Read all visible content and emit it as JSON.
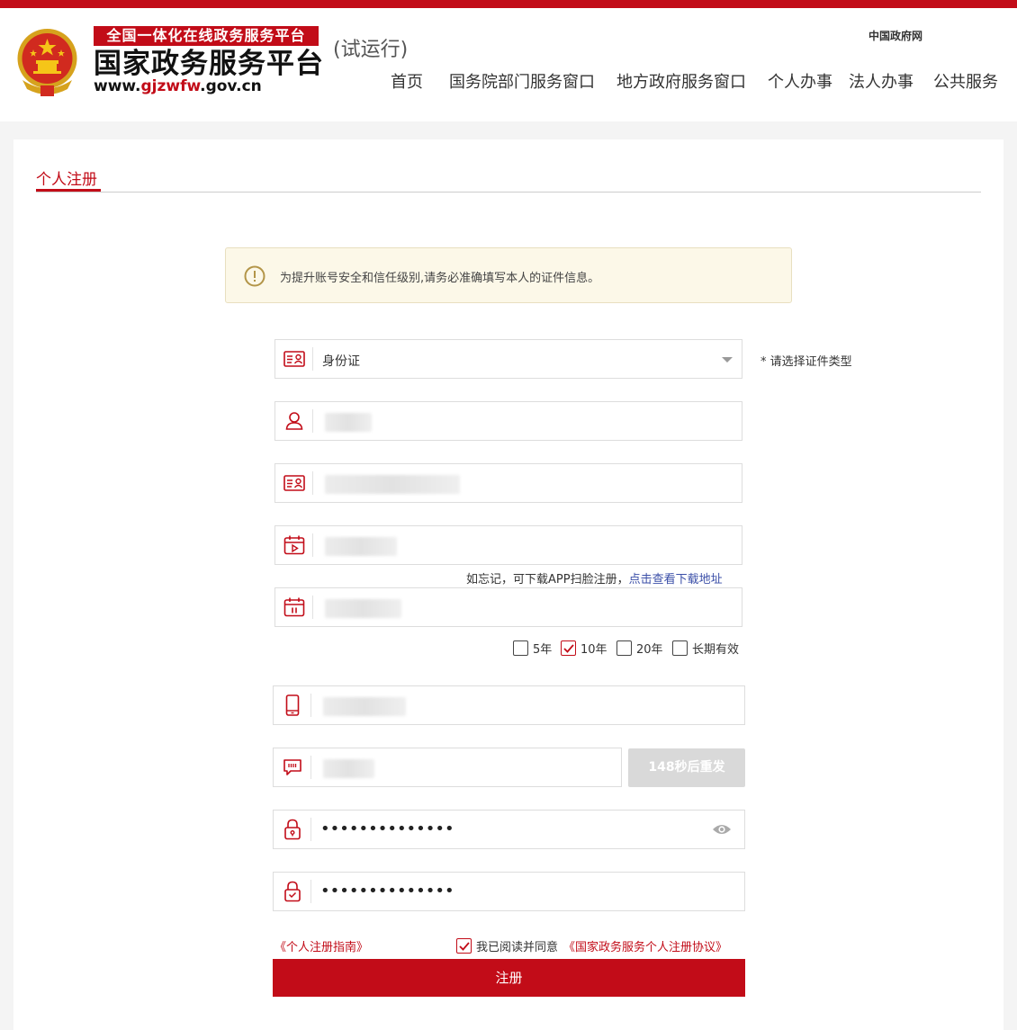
{
  "colors": {
    "brand_red": "#c20c18",
    "notice_bg": "#fcf8e8",
    "link_blue": "#3b4fa8",
    "disabled_gray": "#d9d9d9"
  },
  "header": {
    "logo_tag": "全国一体化在线政务服务平台",
    "logo_name": "国家政务服务平台",
    "logo_url_prefix": "www.",
    "logo_url_highlight": "gjzwfw",
    "logo_url_suffix": ".gov.cn",
    "trial": "(试运行)",
    "gov_link": "中国政府网",
    "nav": [
      "首页",
      "国务院部门服务窗口",
      "地方政府服务窗口",
      "个人办事",
      "法人办事",
      "公共服务"
    ]
  },
  "page": {
    "tab_title": "个人注册"
  },
  "notice": {
    "icon": "alert-circle-icon",
    "text": "为提升账号安全和信任级别,请务必准确填写本人的证件信息。"
  },
  "form": {
    "id_type": {
      "icon": "id-card-icon",
      "value": "身份证",
      "hint": "* 请选择证件类型"
    },
    "name": {
      "icon": "user-icon"
    },
    "id_number": {
      "icon": "id-card-icon"
    },
    "start_date": {
      "icon": "calendar-start-icon"
    },
    "forgot_text": "如忘记，可下载APP扫脸注册，",
    "forgot_link": "点击查看下载地址",
    "end_date": {
      "icon": "calendar-end-icon"
    },
    "validity_options": [
      {
        "label": "5年",
        "checked": false
      },
      {
        "label": "10年",
        "checked": true
      },
      {
        "label": "20年",
        "checked": false
      },
      {
        "label": "长期有效",
        "checked": false
      }
    ],
    "phone": {
      "icon": "mobile-icon"
    },
    "sms_code": {
      "icon": "message-icon",
      "resend_label": "148秒后重发"
    },
    "password": {
      "icon": "lock-icon",
      "value": "••••••••••••••"
    },
    "confirm_password": {
      "icon": "lock-check-icon",
      "value": "••••••••••••••"
    },
    "guide_link": "《个人注册指南》",
    "agree_text": "我已阅读并同意",
    "agree_link": "《国家政务服务个人注册协议》",
    "agree_checked": true,
    "submit_label": "注册"
  }
}
